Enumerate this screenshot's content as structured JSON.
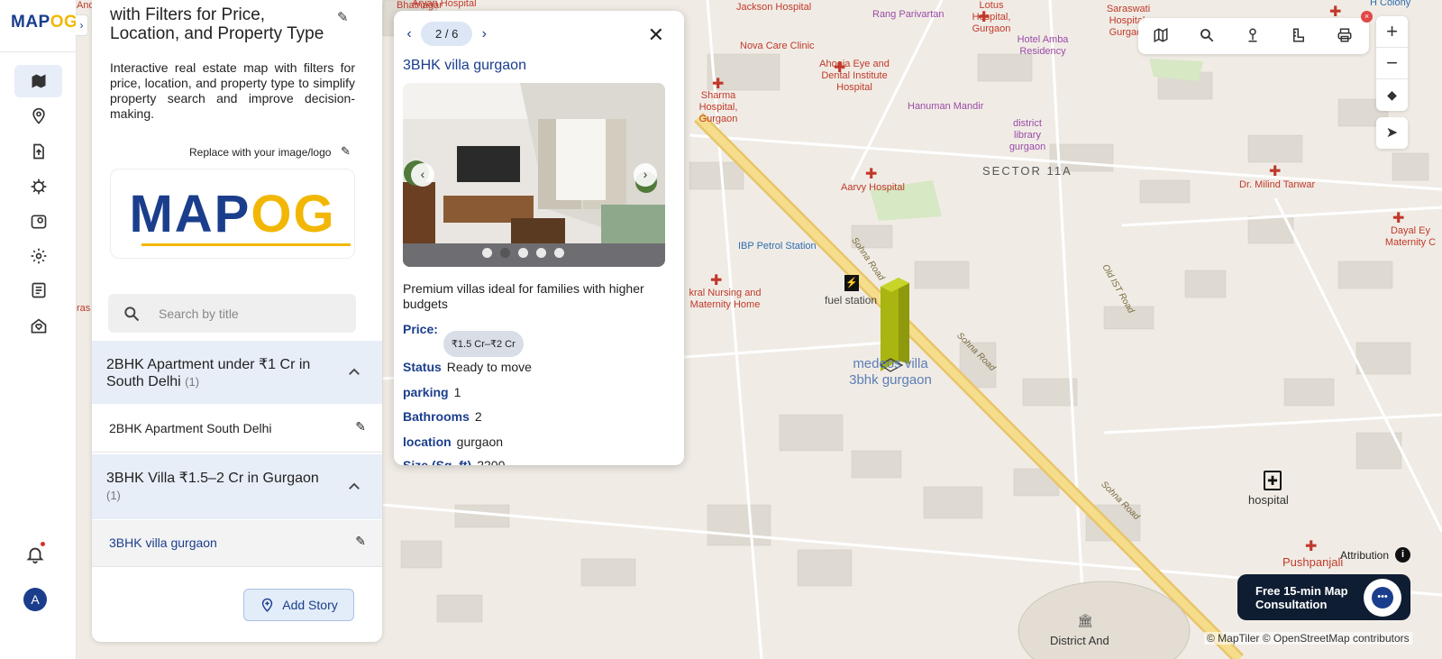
{
  "app": {
    "logo_a": "MAP",
    "logo_b": "OG"
  },
  "nav": {
    "toggle": "›",
    "avatar_letter": "A"
  },
  "story": {
    "title": "with Filters for Price, Location, and Property Type",
    "description": "Interactive real estate map with filters for price, location, and property type to simplify property search and improve decision-making.",
    "replace_logo_label": "Replace with your image/logo",
    "logo_text_a": "MAP",
    "logo_text_b": "OG",
    "search_placeholder": "Search by title",
    "groups": [
      {
        "title": "2BHK Apartment under ₹1 Cr in South Delhi",
        "count": "(1)",
        "items": [
          "2BHK Apartment South Delhi"
        ]
      },
      {
        "title": "3BHK Villa ₹1.5–2 Cr in Gurgaon",
        "count": "(1)",
        "items": [
          "3BHK villa gurgaon"
        ]
      }
    ],
    "add_story_label": "Add Story"
  },
  "popup": {
    "pager": "2 / 6",
    "title": "3BHK villa gurgaon",
    "description": "Premium villas ideal for families with higher budgets",
    "price_label": "Price:",
    "price_value": "₹1.5 Cr–₹2 Cr",
    "fields": [
      {
        "key": "Status",
        "value": "Ready to move"
      },
      {
        "key": "parking",
        "value": "1"
      },
      {
        "key": "Bathrooms",
        "value": "2"
      },
      {
        "key": "location",
        "value": "gurgaon"
      },
      {
        "key": "Size (Sq. ft)",
        "value": "2200"
      }
    ],
    "image_count": 5,
    "active_image_index": 1
  },
  "map": {
    "labels": {
      "and_tribal": "And Tribal Art",
      "bhatnagar": "Bhatnagar",
      "aryan": "Aryan Hospital",
      "jackson": "Jackson Hospital",
      "rang": "Rang Parivartan",
      "lotus": "Lotus Hospital, Gurgaon",
      "saraswati": "Saraswati Hospital, Gurgaon",
      "colony": "H Colony",
      "nova": "Nova Care Clinic",
      "hotel_amba": "Hotel Amba Residency",
      "ahooja": "Ahooja Eye and Dental Institute Hospital",
      "sharma": "Sharma Hospital, Gurgaon",
      "hanuman": "Hanuman Mandir",
      "library": "district library gurgaon",
      "sector": "SECTOR 11A",
      "aarvy": "Aarvy Hospital",
      "milind": "Dr. Milind Tanwar",
      "dayal": "Dayal Ey Maternity C",
      "ibp": "IBP Petrol Station",
      "fuel": "fuel station",
      "kral": "kral Nursing and Maternity Home",
      "medeos": "medeos villa 3bhk gurgaon",
      "hospital": "hospital",
      "pushpanjali": "Pushpanjali",
      "district": "District And",
      "sohna1": "Sohna Road",
      "sohna2": "Sohna Road",
      "sohna3": "Sohna Road",
      "old_ist": "Old IST Road",
      "ras": "ras"
    },
    "attribution": "Attribution",
    "attribution_info": "i",
    "credits": "© MapTiler © OpenStreetMap contributors",
    "close_badge": "×",
    "zoom_in": "+",
    "zoom_out": "−",
    "compass": "◆",
    "locate": "➤",
    "consult_text": "Free 15-min Map Consultation"
  }
}
